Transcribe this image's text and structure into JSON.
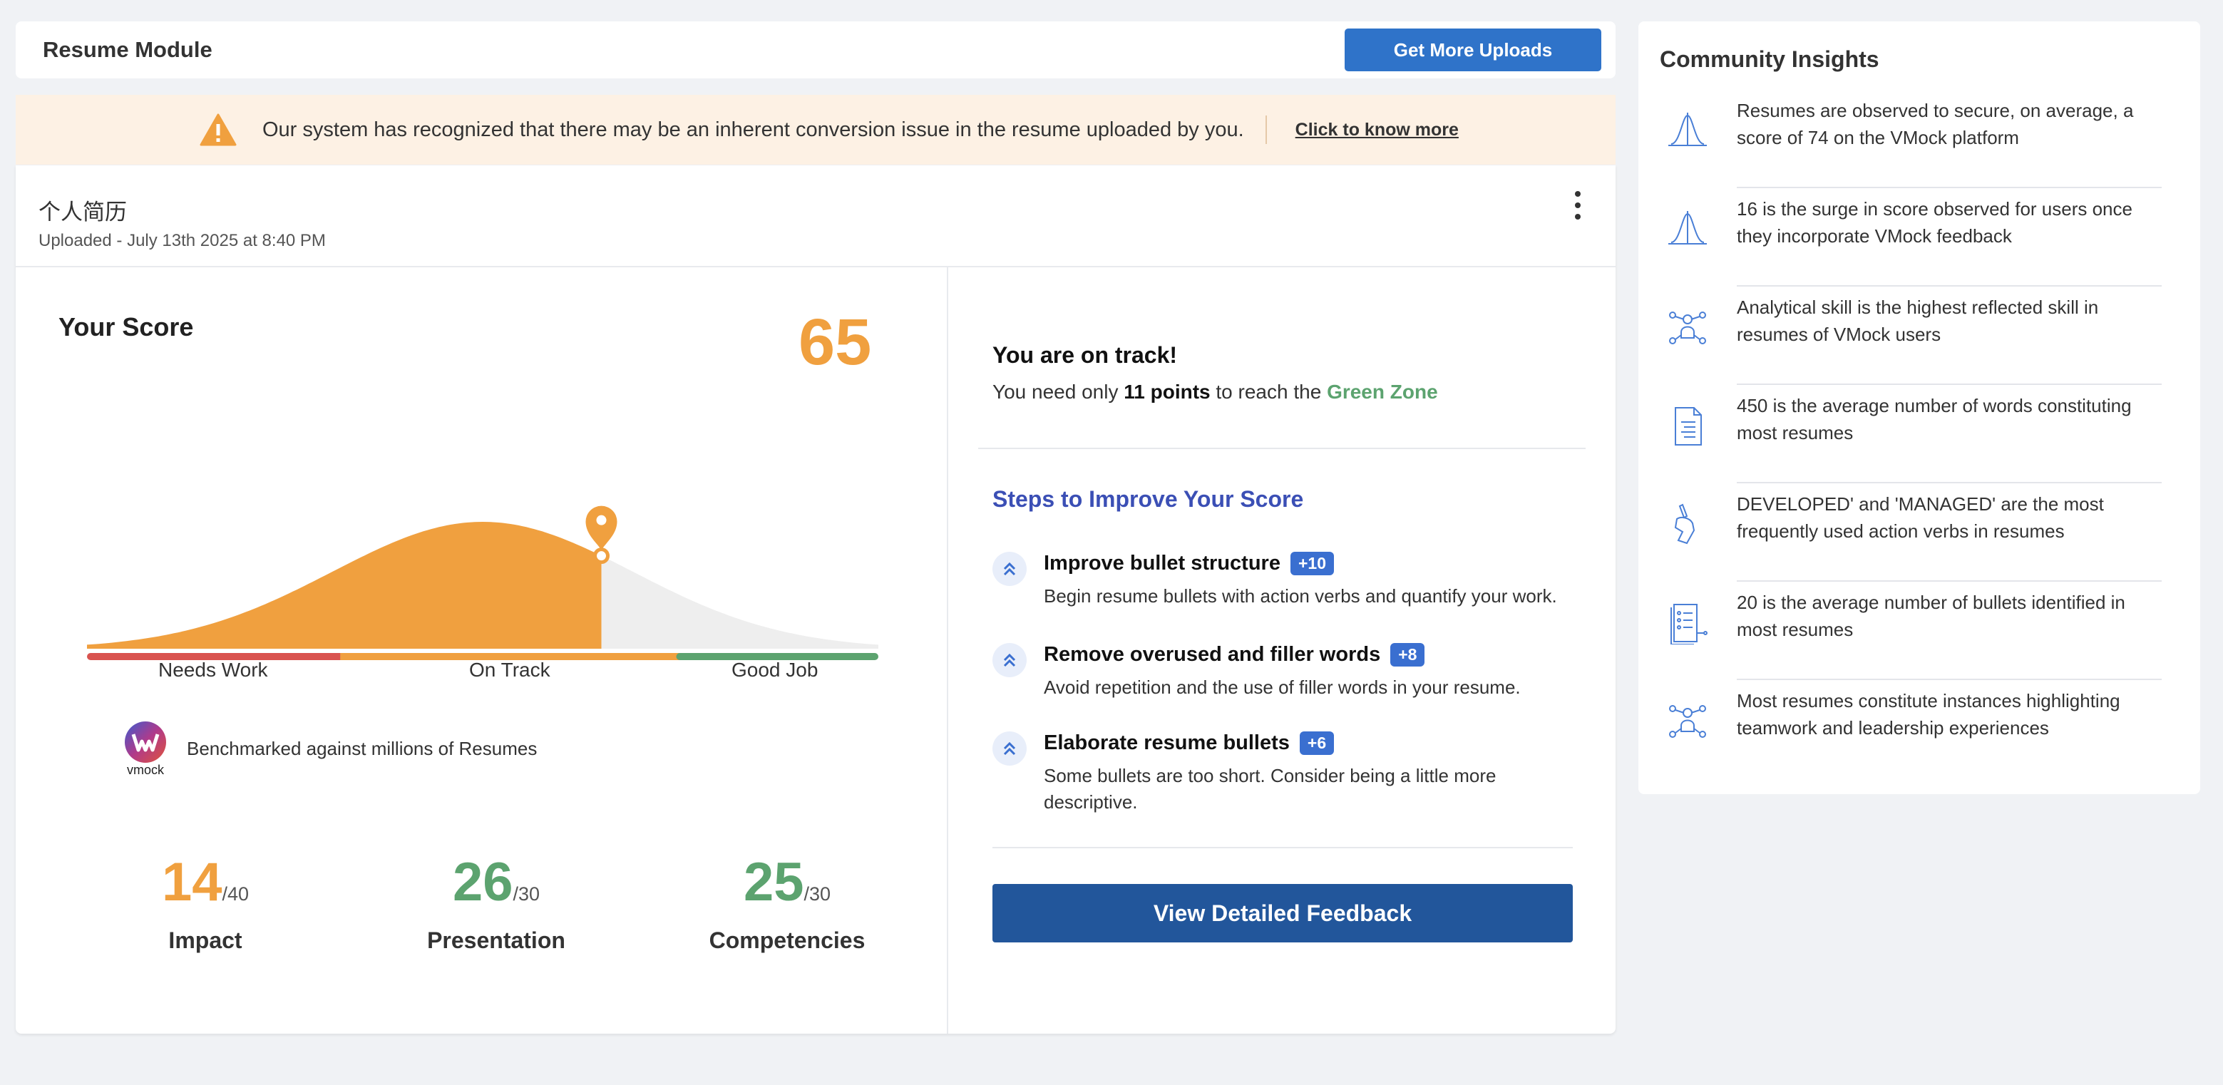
{
  "header": {
    "title": "Resume Module",
    "upload_button": "Get More Uploads"
  },
  "banner": {
    "message": "Our system has recognized that there may be an inherent conversion issue in the resume uploaded by you.",
    "link": "Click to know more"
  },
  "document": {
    "name": "个人简历",
    "uploaded": "Uploaded - July 13th 2025 at 8:40 PM"
  },
  "score": {
    "label": "Your Score",
    "value": "65",
    "percentile_position": 0.65,
    "zones": [
      "Needs Work",
      "On Track",
      "Good Job"
    ],
    "benchmark": "Benchmarked against millions of Resumes",
    "logo_text": "vmock",
    "subscores": [
      {
        "value": "14",
        "max": "/40",
        "name": "Impact",
        "color": "#f0a03f"
      },
      {
        "value": "26",
        "max": "/30",
        "name": "Presentation",
        "color": "#5ca36f"
      },
      {
        "value": "25",
        "max": "/30",
        "name": "Competencies",
        "color": "#5ca36f"
      }
    ],
    "colors": {
      "needs_work": "#d9534f",
      "on_track": "#f0a03f",
      "good_job": "#5ca36f",
      "curve_fill": "#f0a03f",
      "curve_rest": "#eeeeee"
    }
  },
  "status": {
    "title": "You are on track!",
    "desc_before": "You need only ",
    "points": "11 points",
    "desc_mid": " to reach the ",
    "zone": "Green Zone"
  },
  "steps": {
    "title": "Steps to Improve Your Score",
    "items": [
      {
        "title": "Improve bullet structure",
        "badge": "+10",
        "desc": "Begin resume bullets with action verbs and quantify your work.",
        "icon": "chevrons-up-icon"
      },
      {
        "title": "Remove overused and filler words",
        "badge": "+8",
        "desc": "Avoid repetition and the use of filler words in your resume.",
        "icon": "chevrons-up-icon"
      },
      {
        "title": "Elaborate resume bullets",
        "badge": "+6",
        "desc": "Some bullets are too short. Consider being a little more descriptive.",
        "icon": "chevrons-up-icon"
      }
    ],
    "button": "View Detailed Feedback"
  },
  "insights": {
    "title": "Community Insights",
    "items": [
      {
        "icon": "bell-curve-icon",
        "text": "Resumes are observed to secure, on average, a score of 74 on the VMock platform"
      },
      {
        "icon": "bell-curve-icon",
        "text": "16 is the surge in score observed for users once they incorporate VMock feedback"
      },
      {
        "icon": "network-people-icon",
        "text": "Analytical skill is the highest reflected skill in resumes of VMock users"
      },
      {
        "icon": "document-icon",
        "text": "450 is the average number of words constituting most resumes"
      },
      {
        "icon": "hand-pen-icon",
        "text": "DEVELOPED' and 'MANAGED' are the most frequently used action verbs in resumes"
      },
      {
        "icon": "bullet-list-doc-icon",
        "text": "20 is the average number of bullets identified in most resumes"
      },
      {
        "icon": "network-people-icon",
        "text": "Most resumes constitute instances highlighting teamwork and leadership experiences"
      }
    ]
  }
}
